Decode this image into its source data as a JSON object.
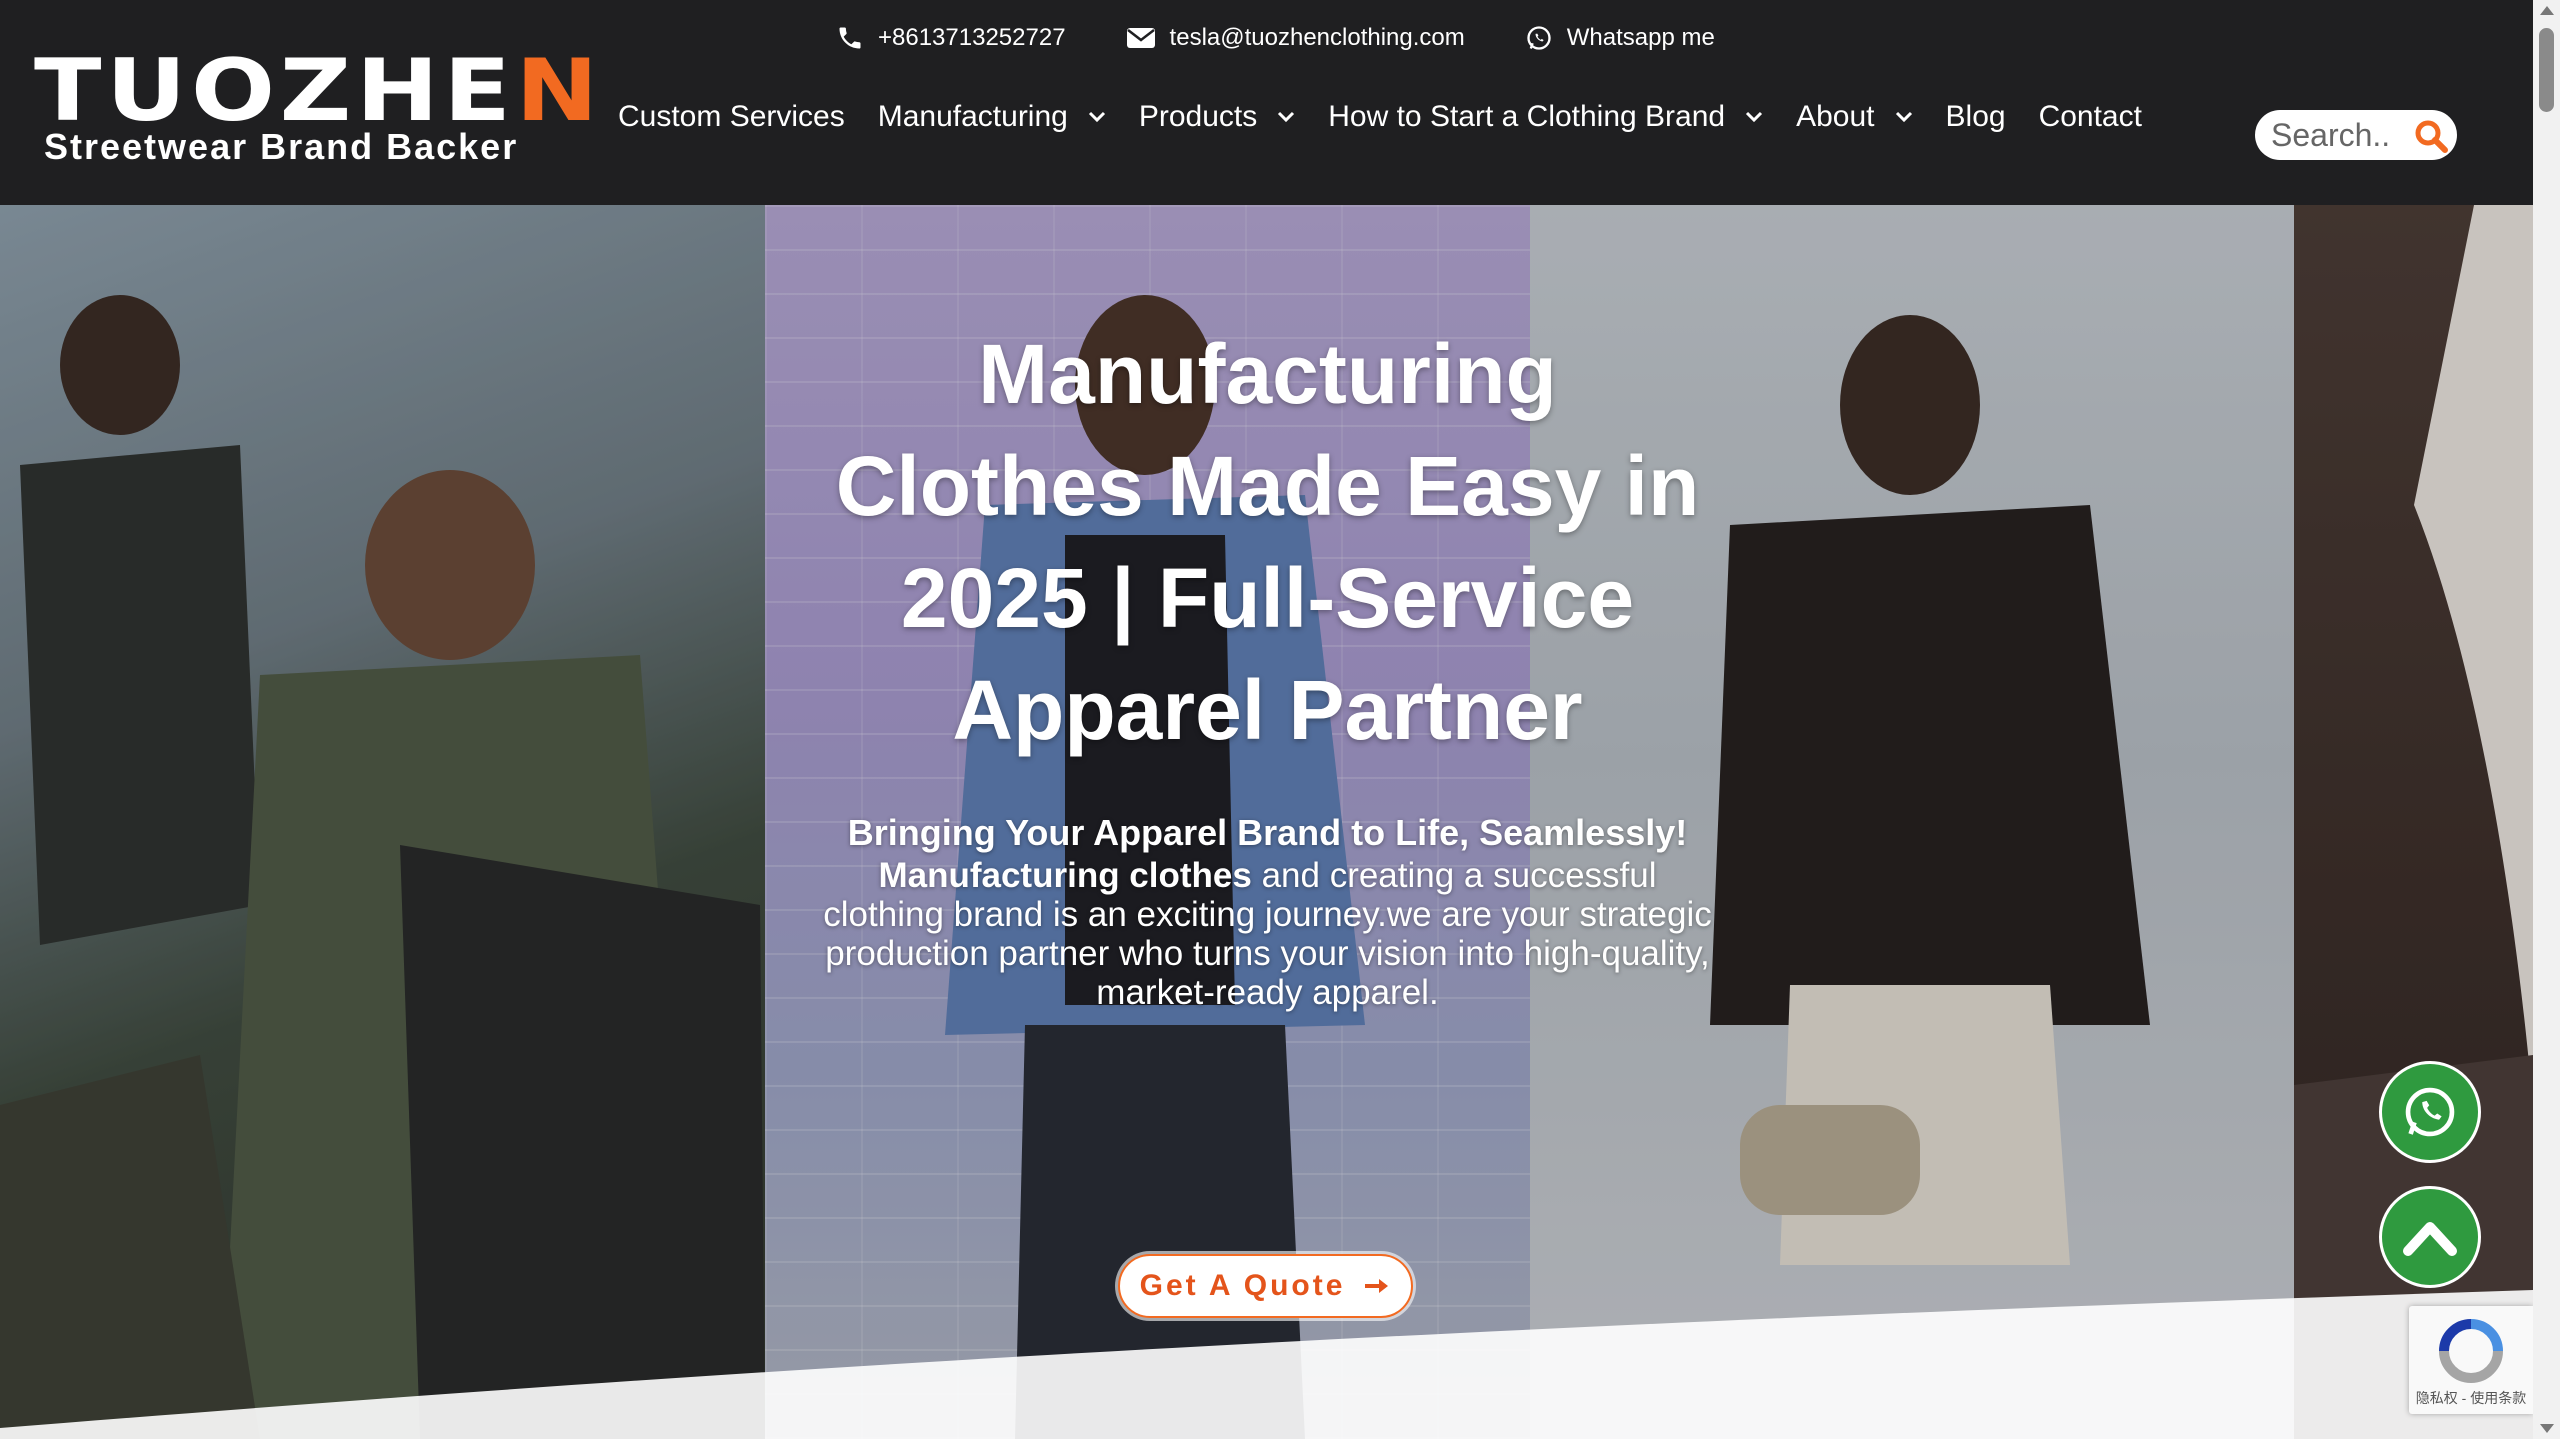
{
  "header": {
    "logo": {
      "main_prefix": "TUOZHE",
      "main_accent": "N",
      "tagline": "Streetwear Brand Backer"
    },
    "contacts": [
      {
        "icon": "phone-icon",
        "text": "+8613713252727"
      },
      {
        "icon": "envelope-icon",
        "text": "tesla@tuozhenclothing.com"
      },
      {
        "icon": "whatsapp-icon",
        "text": "Whatsapp me"
      }
    ],
    "nav": [
      {
        "label": "Custom Services",
        "dropdown": false
      },
      {
        "label": "Manufacturing",
        "dropdown": true
      },
      {
        "label": "Products",
        "dropdown": true
      },
      {
        "label": "How to Start a Clothing Brand",
        "dropdown": true
      },
      {
        "label": "About",
        "dropdown": true
      },
      {
        "label": "Blog",
        "dropdown": false
      },
      {
        "label": "Contact",
        "dropdown": false
      }
    ],
    "search": {
      "placeholder": "Search..",
      "icon": "search-icon"
    }
  },
  "hero": {
    "title": "Manufacturing Clothes Made Easy in 2025 | Full-Service Apparel Partner",
    "lead": "Bringing Your Apparel Brand to Life, Seamlessly!",
    "body_strong": "Manufacturing clothes",
    "body_rest": " and creating a successful clothing brand is an exciting journey.we are your strategic production partner who turns your vision into high-quality, market-ready apparel.",
    "cta_label": "Get A Quote",
    "cta_icon": "arrow-right-icon"
  },
  "floating": {
    "whatsapp_icon": "whatsapp-icon",
    "back_to_top_icon": "chevron-up-icon"
  },
  "recaptcha": {
    "footer_text": "隐私权 - 使用条款"
  },
  "colors": {
    "header_bg": "#1f1f21",
    "accent": "#f26a21",
    "floating_green": "#2f9a3f"
  }
}
